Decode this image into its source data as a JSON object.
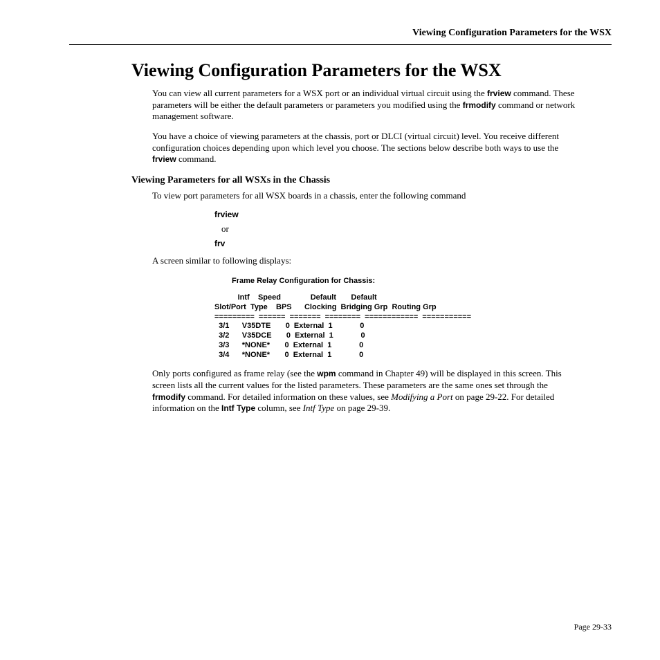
{
  "header": {
    "running_title": "Viewing Configuration Parameters for the WSX"
  },
  "title": "Viewing Configuration Parameters for the WSX",
  "para1": {
    "t1": "You can view all current parameters for a WSX port or an individual virtual circuit using the ",
    "b1": "frview",
    "t2": " command. These parameters will be either the default parameters or parameters you modified using the ",
    "b2": "frmodify",
    "t3": " command or network management software."
  },
  "para2": {
    "t1": "You have a choice of viewing parameters at the chassis, port or DLCI (virtual circuit) level. You receive different configuration choices depending upon which level you choose. The sections below describe both ways to use the ",
    "b1": "frview",
    "t2": " command."
  },
  "subheading1": "Viewing Parameters for all WSXs in the Chassis",
  "para3": "To view port parameters for all WSX boards in a chassis, enter the following command",
  "cmd1": "frview",
  "or": "or",
  "cmd2": "frv",
  "para4": "A screen similar to following displays:",
  "table": {
    "title": "Frame Relay Configuration for Chassis:",
    "h1a": "",
    "h1b": "Intf",
    "h1c": "Speed",
    "h1d": "",
    "h1e": "Default",
    "h1f": "Default",
    "h2a": "Slot/Port",
    "h2b": "Type",
    "h2c": "BPS",
    "h2d": "Clocking",
    "h2e": "Bridging Grp",
    "h2f": "Routing Grp",
    "rule": "=========  ======  =======  ========  ============  ===========",
    "rows": [
      {
        "a": "3/1",
        "b": "V35DTE",
        "c": "0",
        "d": "External",
        "e": "1",
        "f": "0"
      },
      {
        "a": "3/2",
        "b": "V35DCE",
        "c": "0",
        "d": "External",
        "e": "1",
        "f": "0"
      },
      {
        "a": "3/3",
        "b": "*NONE*",
        "c": "0",
        "d": "External",
        "e": "1",
        "f": "0"
      },
      {
        "a": "3/4",
        "b": "*NONE*",
        "c": "0",
        "d": "External",
        "e": "1",
        "f": "0"
      }
    ]
  },
  "para5": {
    "t1": "Only ports configured as frame relay (see the ",
    "b1": "wpm",
    "t2": " command in Chapter 49) will be displayed in this screen. This screen lists all the current values for the listed parameters. These parameters are the same ones set through the ",
    "b2": "frmodify",
    "t3": " command. For detailed information on these values, see ",
    "i1": "Modifying a Port",
    "t4": " on page 29-22. For detailed information on the ",
    "b3": "Intf Type",
    "t5": " column, see ",
    "i2": "Intf Type",
    "t6": " on page 29-39."
  },
  "page_number": "Page 29-33"
}
